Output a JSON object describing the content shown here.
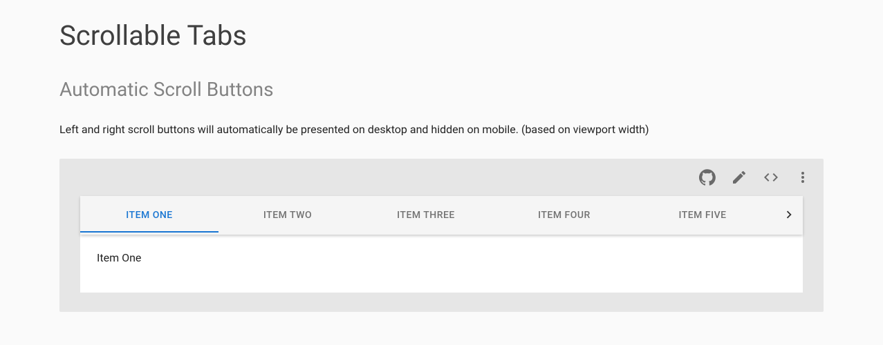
{
  "page": {
    "title": "Scrollable Tabs",
    "subtitle": "Automatic Scroll Buttons",
    "description": "Left and right scroll buttons will automatically be presented on desktop and hidden on mobile. (based on viewport width)"
  },
  "toolbar": {
    "icons": {
      "github": "github-icon",
      "edit": "edit-icon",
      "code": "code-icon",
      "more": "more-vert-icon"
    }
  },
  "tabs": {
    "items": [
      {
        "label": "ITEM ONE",
        "active": true
      },
      {
        "label": "ITEM TWO",
        "active": false
      },
      {
        "label": "ITEM THREE",
        "active": false
      },
      {
        "label": "ITEM FOUR",
        "active": false
      },
      {
        "label": "ITEM FIVE",
        "active": false
      }
    ],
    "panel_content": "Item One"
  }
}
